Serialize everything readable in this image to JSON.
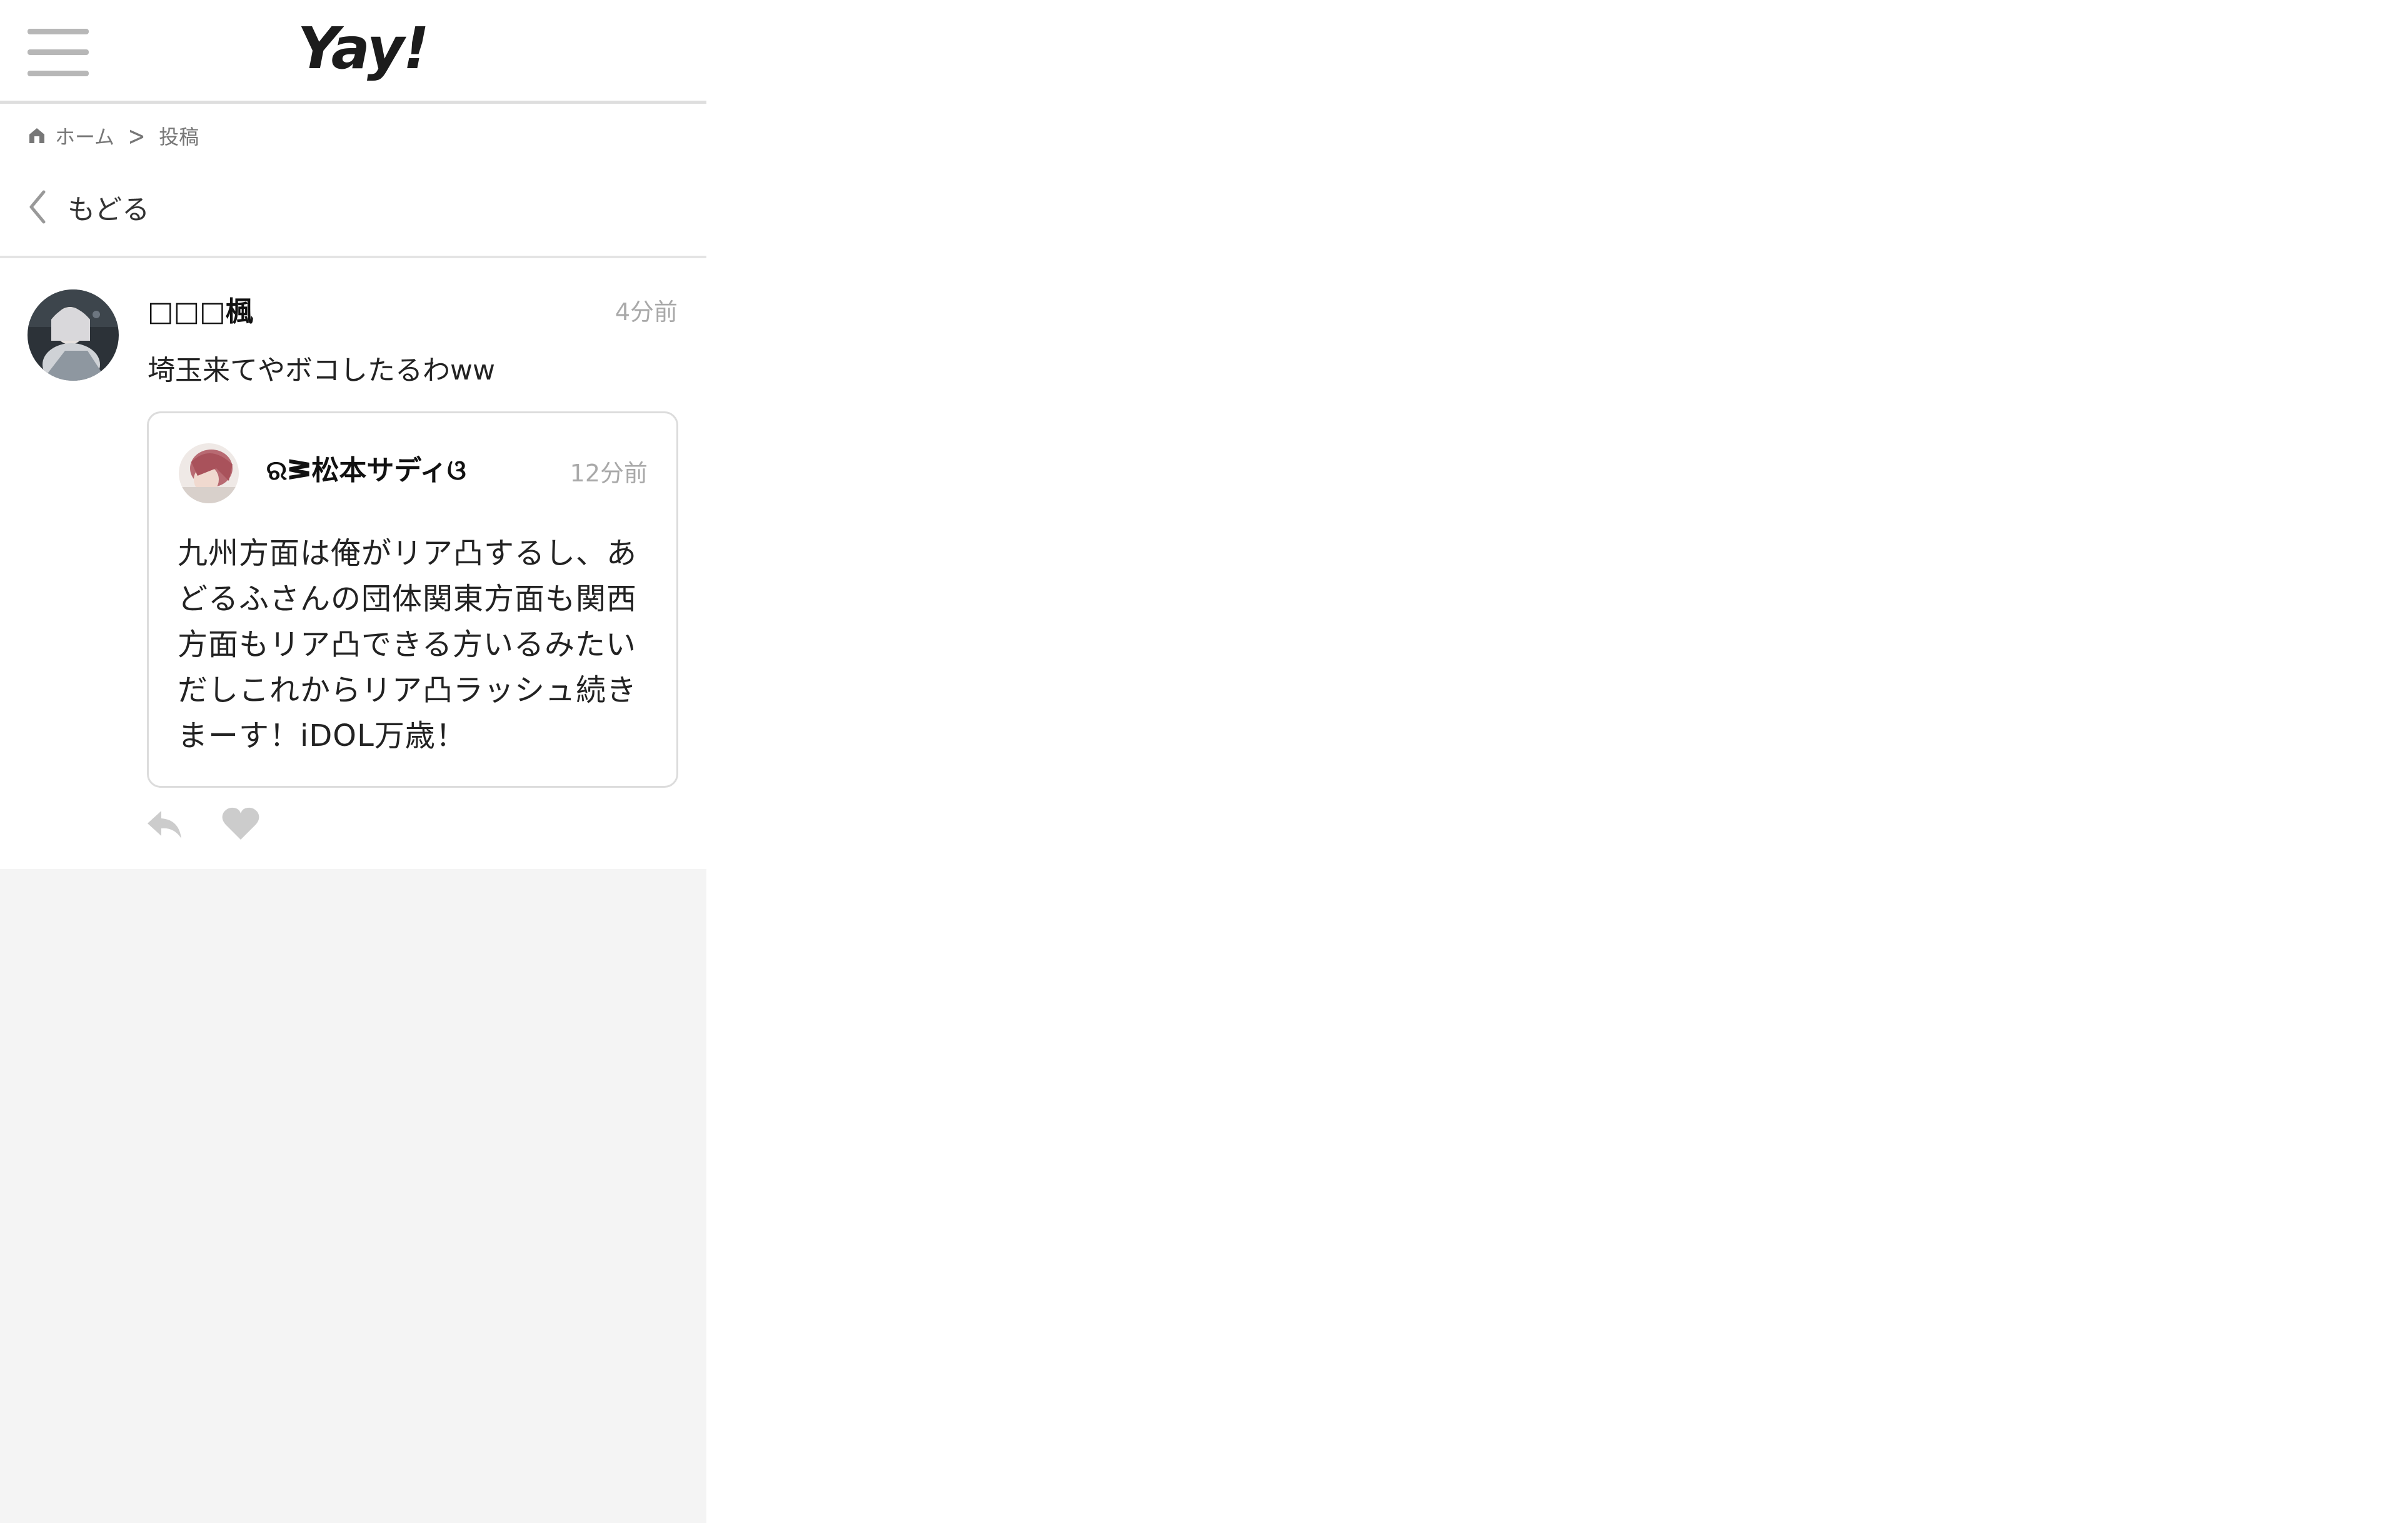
{
  "app": {
    "logo_text": "Yay!",
    "menu_icon": "hamburger-menu-icon"
  },
  "breadcrumb": {
    "home_icon": "home-icon",
    "home_label": "ホーム",
    "separator": ">",
    "current_label": "投稿"
  },
  "back": {
    "icon": "chevron-left-icon",
    "label": "もどる"
  },
  "post": {
    "username": "□□□楓",
    "time": "4分前",
    "text": "埼玉来てやボコしたるわww",
    "quote": {
      "username": "ରᕒ松本サディଓ",
      "time": "12分前",
      "text": "九州方面は俺がリア凸するし、あどるふさんの団体関東方面も関西方面もリア凸できる方いるみたいだしこれからリア凸ラッシュ続きまーす！iDOL万歳！"
    },
    "actions": {
      "reply_icon": "reply-icon",
      "like_icon": "heart-icon"
    }
  },
  "colors": {
    "border": "#dedede",
    "muted_text": "#a9a9a9",
    "page_background": "#f4f4f4",
    "icon_gray": "#cccccc"
  }
}
